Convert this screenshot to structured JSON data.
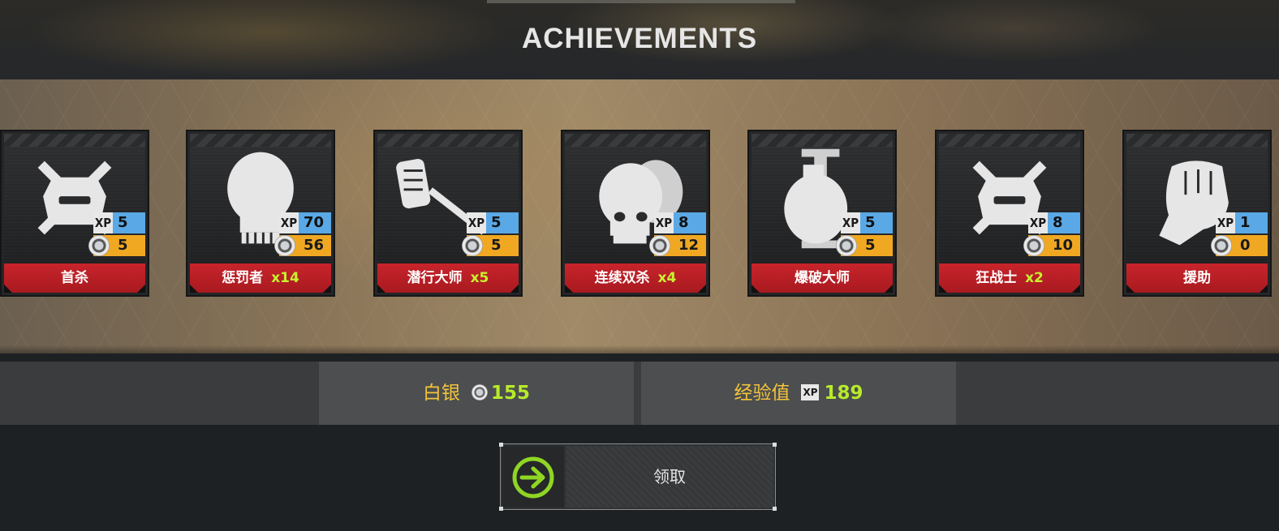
{
  "header": {
    "title": "ACHIEVEMENTS"
  },
  "achievements": [
    {
      "name": "首杀",
      "multiplier": "",
      "xp": "5",
      "silver": "5",
      "icon": "skull-crossed-bones-icon"
    },
    {
      "name": "惩罚者",
      "multiplier": "x14",
      "xp": "70",
      "silver": "56",
      "icon": "punisher-skull-icon"
    },
    {
      "name": "潜行大师",
      "multiplier": "x5",
      "xp": "5",
      "silver": "5",
      "icon": "skeleton-hand-knife-icon"
    },
    {
      "name": "连续双杀",
      "multiplier": "x4",
      "xp": "8",
      "silver": "12",
      "icon": "double-skull-icon"
    },
    {
      "name": "爆破大师",
      "multiplier": "",
      "xp": "5",
      "silver": "5",
      "icon": "grenade-icon"
    },
    {
      "name": "狂战士",
      "multiplier": "x2",
      "xp": "8",
      "silver": "10",
      "icon": "skull-crossed-bones-icon"
    },
    {
      "name": "援助",
      "multiplier": "",
      "xp": "1",
      "silver": "0",
      "icon": "fist-icon"
    }
  ],
  "xp_label": "XP",
  "totals": {
    "silver_label": "白银",
    "silver_value": "155",
    "xp_label": "经验值",
    "xp_icon_text": "XP",
    "xp_value": "189"
  },
  "claim_button": {
    "label": "领取",
    "icon": "arrow-right-circle-icon"
  },
  "colors": {
    "xp_blue": "#5aa9e6",
    "silver_orange": "#f0a823",
    "name_red": "#c8242b",
    "accent_green": "#b7eb2a",
    "label_yellow": "#f2c43a"
  }
}
